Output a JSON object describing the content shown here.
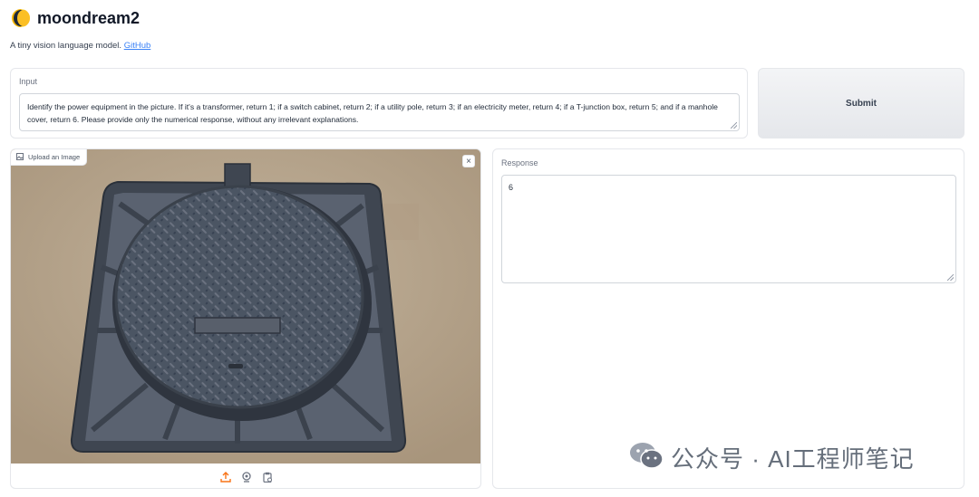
{
  "app": {
    "title": "moondream2",
    "subtitle_prefix": "A tiny vision language model.",
    "subtitle_link": "GitHub"
  },
  "input": {
    "label": "Input",
    "value": "Identify the power equipment in the picture. If it's a transformer, return 1; if a switch cabinet, return 2; if a utility pole, return 3; if an electricity meter, return 4; if a T-junction box, return 5; and if a manhole cover, return 6. Please provide only the numerical response, without any irrelevant explanations."
  },
  "submit_label": "Submit",
  "image": {
    "upload_label": "Upload an Image",
    "close_symbol": "×",
    "toolbar_icons": [
      "upload-icon",
      "webcam-icon",
      "clipboard-icon"
    ],
    "accent": "#f97316"
  },
  "response": {
    "label": "Response",
    "value": "6"
  },
  "watermark": {
    "text": "公众号 · AI工程师笔记"
  }
}
